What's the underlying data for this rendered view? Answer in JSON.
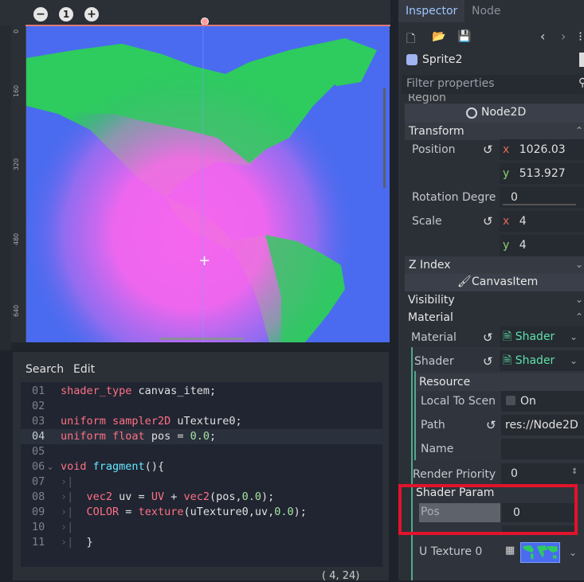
{
  "viewport": {
    "zoom_out": "−",
    "zoom_reset": "1",
    "zoom_in": "+",
    "ruler_ticks": [
      "0",
      "160",
      "320",
      "480",
      "640"
    ]
  },
  "script_editor": {
    "menu": {
      "search": "Search",
      "edit": "Edit"
    },
    "lines": [
      {
        "num": "01",
        "text": "shader_type canvas_item;"
      },
      {
        "num": "02",
        "text": ""
      },
      {
        "num": "03",
        "text": "uniform sampler2D uTexture0;"
      },
      {
        "num": "04",
        "text": "uniform float pos = 0.0;"
      },
      {
        "num": "05",
        "text": ""
      },
      {
        "num": "06",
        "text": "void fragment(){"
      },
      {
        "num": "07",
        "text": ""
      },
      {
        "num": "08",
        "text": "vec2 uv = UV + vec2(pos,0.0);"
      },
      {
        "num": "09",
        "text": "COLOR = texture(uTexture0,uv,0.0);"
      },
      {
        "num": "10",
        "text": ""
      },
      {
        "num": "11",
        "text": "}"
      }
    ],
    "cursor_position": "(   4,  24)"
  },
  "inspector": {
    "tabs": {
      "inspector": "Inspector",
      "node": "Node"
    },
    "node_name": "Sprite2",
    "filter_placeholder": "Filter properties",
    "region_label": "Region",
    "node2d_label": "Node2D",
    "transform": {
      "title": "Transform",
      "position_label": "Position",
      "position_x": "1026.03",
      "position_y": "513.927",
      "rotation_label": "Rotation Degre",
      "rotation_value": "0",
      "scale_label": "Scale",
      "scale_x": "4",
      "scale_y": "4"
    },
    "axis_x": "x",
    "axis_y": "y",
    "z_index_title": "Z Index",
    "canvas_item_label": "CanvasItem",
    "visibility_title": "Visibility",
    "material_title": "Material",
    "material": {
      "material_label": "Material",
      "material_value": "Shader",
      "shader_label": "Shader",
      "shader_value": "Shader",
      "resource_title": "Resource",
      "local_to_scene_label": "Local To Scen",
      "local_to_scene_value": "On",
      "path_label": "Path",
      "path_value": "res://Node2D",
      "name_label": "Name",
      "name_value": "",
      "render_priority_label": "Render Priority",
      "render_priority_value": "0",
      "shader_param_title": "Shader Param",
      "pos_label": "Pos",
      "pos_value": "0",
      "u_texture_label": "U Texture 0"
    }
  },
  "colors": {
    "highlight_box": "#e0142c",
    "ocean": "#4a6bef",
    "land": "#2ecb5e",
    "glow": "#ff66ee"
  }
}
